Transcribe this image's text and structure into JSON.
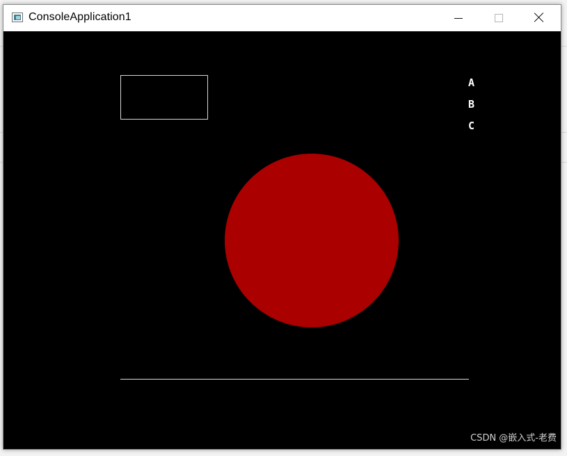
{
  "window": {
    "title": "ConsoleApplication1",
    "icon": "console-app-icon",
    "controls": {
      "minimize_icon": "minimize-icon",
      "maximize_icon": "maximize-icon",
      "close_icon": "close-icon"
    }
  },
  "canvas": {
    "background": "#000000",
    "letters": [
      "A",
      "B",
      "C"
    ],
    "circle_color": "#aa0000",
    "outline_color": "#d9d9d9",
    "line_color": "#dcdcdc"
  },
  "watermark": "CSDN @嵌入式-老费"
}
